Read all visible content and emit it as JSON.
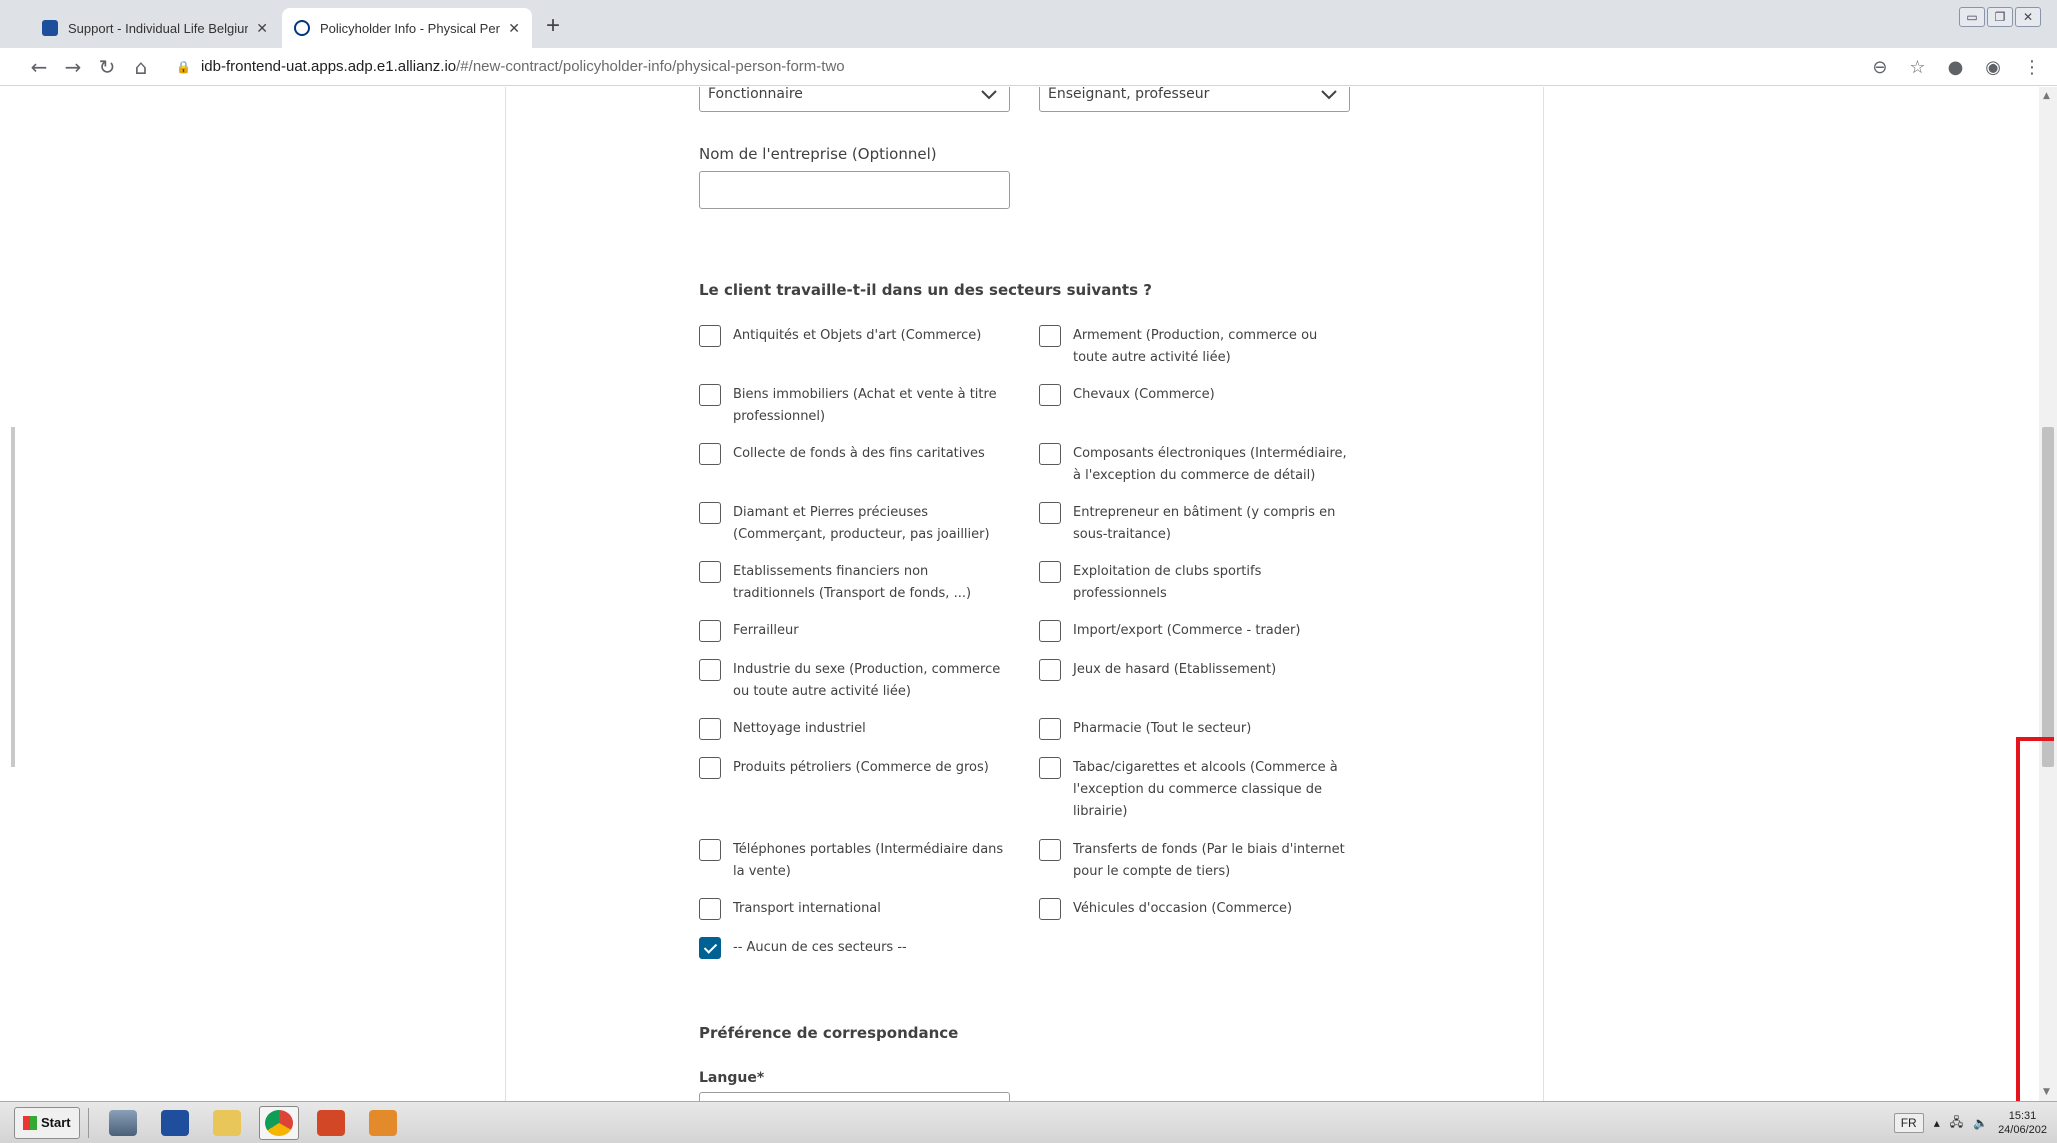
{
  "browser": {
    "tabs": [
      {
        "label": "Support - Individual Life Belgium - All",
        "active": false
      },
      {
        "label": "Policyholder Info - Physical Person -",
        "active": true
      }
    ],
    "url_host": "idb-frontend-uat.apps.adp.e1.allianz.io",
    "url_path": "/#/new-contract/policyholder-info/physical-person-form-two"
  },
  "form": {
    "select_status": "Fonctionnaire",
    "select_profession": "Enseignant, professeur",
    "company_label": "Nom de l'entreprise (Optionnel)",
    "sectors_title": "Le client travaille-t-il dans un des secteurs suivants ?",
    "sectors_left": [
      {
        "label": "Antiquités et Objets d'art (Commerce)",
        "checked": false
      },
      {
        "label": "Biens immobiliers (Achat et vente à titre professionnel)",
        "checked": false
      },
      {
        "label": "Collecte de fonds à des fins caritatives",
        "checked": false
      },
      {
        "label": "Diamant et Pierres précieuses (Commerçant, producteur, pas joaillier)",
        "checked": false
      },
      {
        "label": "Etablissements financiers non traditionnels (Transport de fonds, ...)",
        "checked": false
      },
      {
        "label": "Ferrailleur",
        "checked": false
      },
      {
        "label": "Industrie du sexe (Production, commerce ou toute autre activité liée)",
        "checked": false
      },
      {
        "label": "Nettoyage industriel",
        "checked": false
      },
      {
        "label": "Produits pétroliers (Commerce de gros)",
        "checked": false
      },
      {
        "label": "Téléphones portables (Intermédiaire dans la vente)",
        "checked": false
      },
      {
        "label": "Transport international",
        "checked": false
      },
      {
        "label": "-- Aucun de ces secteurs --",
        "checked": true
      }
    ],
    "sectors_right": [
      {
        "label": "Armement (Production, commerce ou toute autre activité liée)",
        "checked": false
      },
      {
        "label": "Chevaux (Commerce)",
        "checked": false
      },
      {
        "label": "Composants électroniques (Intermédiaire, à l'exception du commerce de détail)",
        "checked": false
      },
      {
        "label": "Entrepreneur en bâtiment (y compris en sous-traitance)",
        "checked": false
      },
      {
        "label": "Exploitation de clubs sportifs professionnels",
        "checked": false
      },
      {
        "label": "Import/export (Commerce - trader)",
        "checked": false
      },
      {
        "label": "Jeux de hasard (Etablissement)",
        "checked": false
      },
      {
        "label": "Pharmacie (Tout le secteur)",
        "checked": false
      },
      {
        "label": "Tabac/cigarettes et alcools (Commerce à l'exception du commerce classique de librairie)",
        "checked": false
      },
      {
        "label": "Transferts de fonds (Par le biais d'internet pour le compte de tiers)",
        "checked": false
      },
      {
        "label": "Véhicules d'occasion (Commerce)",
        "checked": false
      }
    ],
    "correspondence_title": "Préférence de correspondance",
    "language_label": "Langue*"
  },
  "taskbar": {
    "start_label": "Start",
    "language": "FR",
    "time": "15:31",
    "date": "24/06/202"
  },
  "colors": {
    "checkbox_checked": "#006192",
    "highlight": "#e3141b"
  }
}
